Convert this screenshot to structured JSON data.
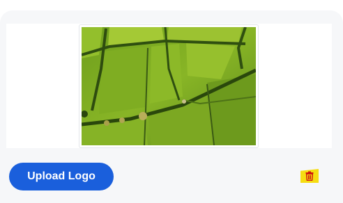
{
  "upload": {
    "button_label": "Upload Logo"
  },
  "preview": {
    "icon": "landscape-photo"
  },
  "actions": {
    "delete_icon": "trash-icon",
    "delete_icon_color": "#d0120f",
    "delete_bg_color": "#f6dd12"
  },
  "colors": {
    "primary": "#1a5fdc",
    "panel_bg": "#f6f7f9"
  }
}
